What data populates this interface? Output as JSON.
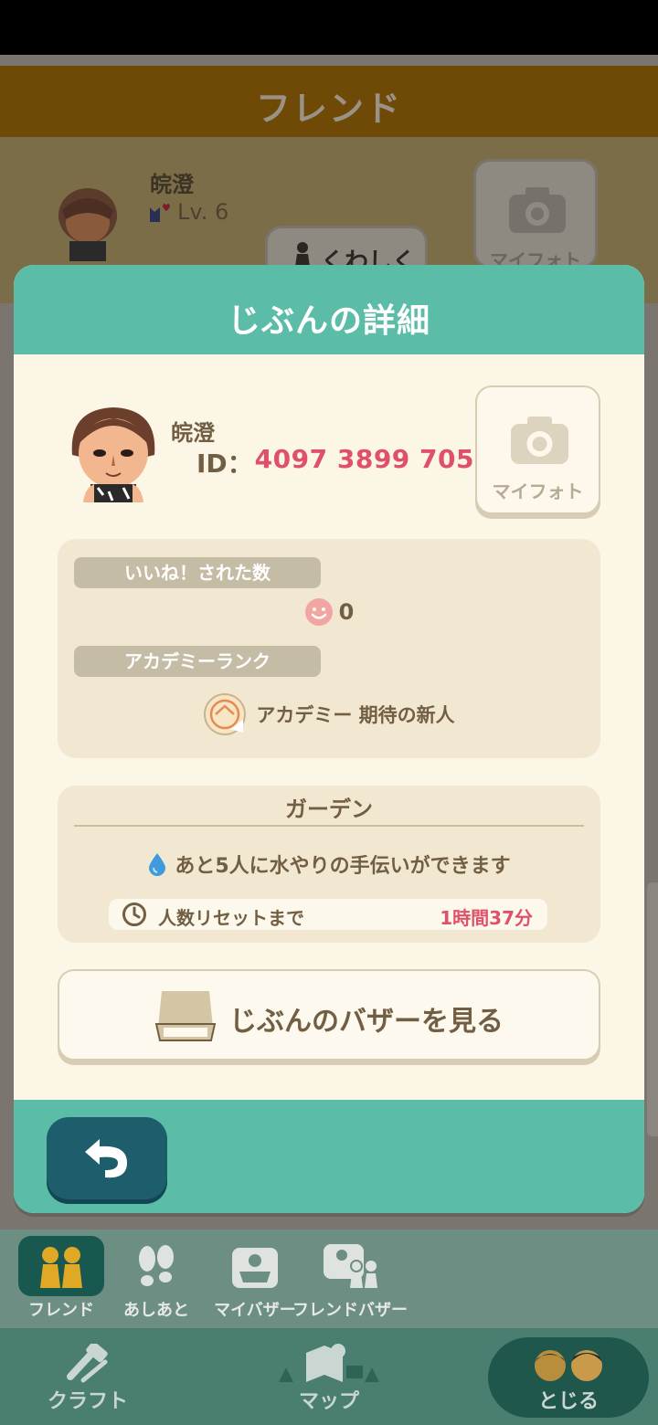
{
  "background": {
    "header_title": "フレンド",
    "friend_name": "皖澄",
    "friend_level": "Lv. 6",
    "detail_button": "くわしく",
    "myphoto_button": "マイフォト"
  },
  "dialog": {
    "title": "じぶんの詳細",
    "user_name": "皖澄",
    "id_label": "ID：",
    "id_value": "4097 3899 705",
    "myphoto_label": "マイフォト",
    "likes_label": "いいね！された数",
    "likes_count": "0",
    "academy_label": "アカデミーランク",
    "academy_rank": "アカデミー 期待の新人",
    "garden_title": "ガーデン",
    "garden_water_text": "あと5人に水やりの手伝いができます",
    "garden_reset_label": "人数リセットまで",
    "garden_reset_value": "1時間37分",
    "bazaar_button": "じぶんのバザーを見る"
  },
  "bottom_nav": {
    "sub_items": [
      {
        "label": "フレンド",
        "icon": "friends-icon",
        "active": true
      },
      {
        "label": "あしあと",
        "icon": "footprints-icon",
        "active": false
      },
      {
        "label": "マイバザー",
        "icon": "bazaar-icon",
        "active": false
      },
      {
        "label": "フレンドバザー",
        "icon": "friend-bazaar-icon",
        "active": false
      }
    ],
    "main_items": [
      {
        "label": "クラフト",
        "icon": "craft-hammer-icon"
      },
      {
        "label": "マップ",
        "icon": "map-icon"
      },
      {
        "label": "とじる",
        "icon": "close-characters-icon"
      }
    ]
  },
  "colors": {
    "header_teal": "#5bbda8",
    "dialog_cream": "#fbf6e6",
    "accent_pink": "#e0506b",
    "back_button": "#1d5d6c"
  }
}
